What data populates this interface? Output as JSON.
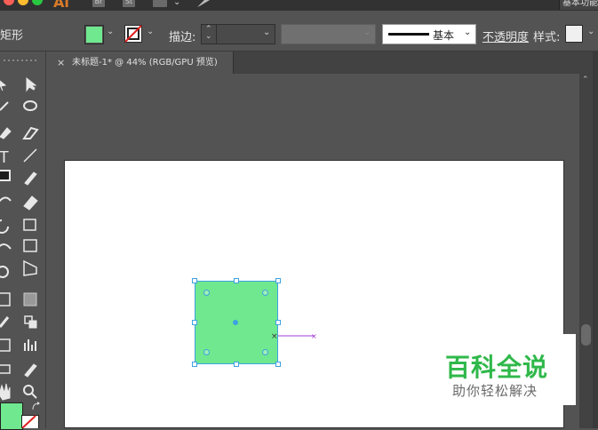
{
  "app": {
    "logo_text": "Ai",
    "br_label": "Br",
    "st_label": "St",
    "workspace_label": "基本功能"
  },
  "controlbar": {
    "selection_label": "矩形",
    "fill_color": "#6fe88f",
    "stroke_label": "描边:",
    "stroke_style_label": "基本",
    "opacity_label": "不透明度",
    "style_label": "样式:"
  },
  "document": {
    "tab_title": "未标题-1* @ 44% (RGB/GPU 预览)",
    "close_glyph": "×"
  },
  "canvas": {
    "shape_fill": "#6fe88f",
    "selection_color": "#3ea2e0"
  },
  "watermark": {
    "title": "百科全说",
    "subtitle": "助你轻松解决"
  }
}
